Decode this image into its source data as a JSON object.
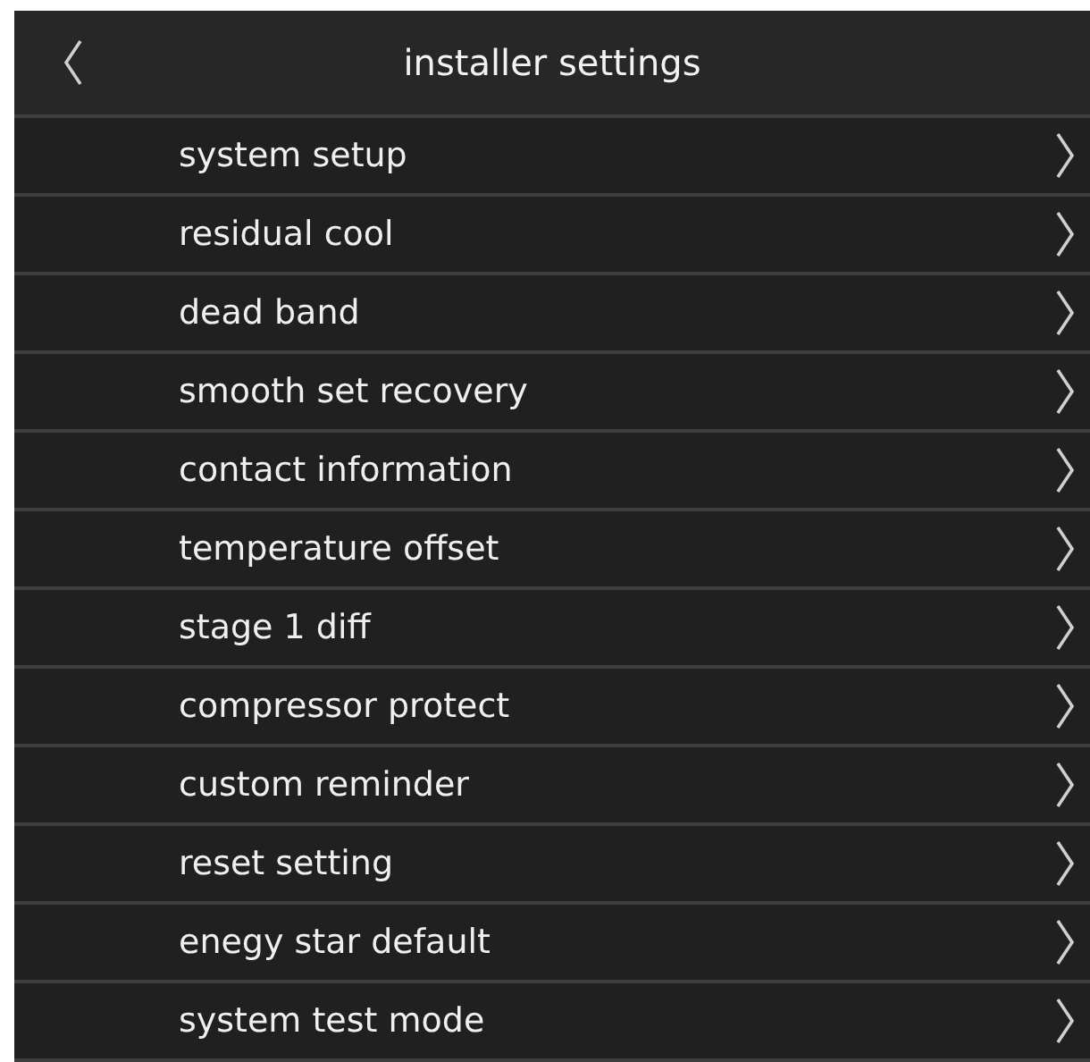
{
  "header": {
    "title": "installer settings"
  },
  "items": [
    {
      "label": "system setup"
    },
    {
      "label": "residual cool"
    },
    {
      "label": "dead band"
    },
    {
      "label": "smooth set recovery"
    },
    {
      "label": "contact information"
    },
    {
      "label": "temperature offset"
    },
    {
      "label": "stage 1 diff"
    },
    {
      "label": "compressor protect"
    },
    {
      "label": "custom reminder"
    },
    {
      "label": "reset setting"
    },
    {
      "label": "enegy star default"
    },
    {
      "label": "system test mode"
    }
  ]
}
